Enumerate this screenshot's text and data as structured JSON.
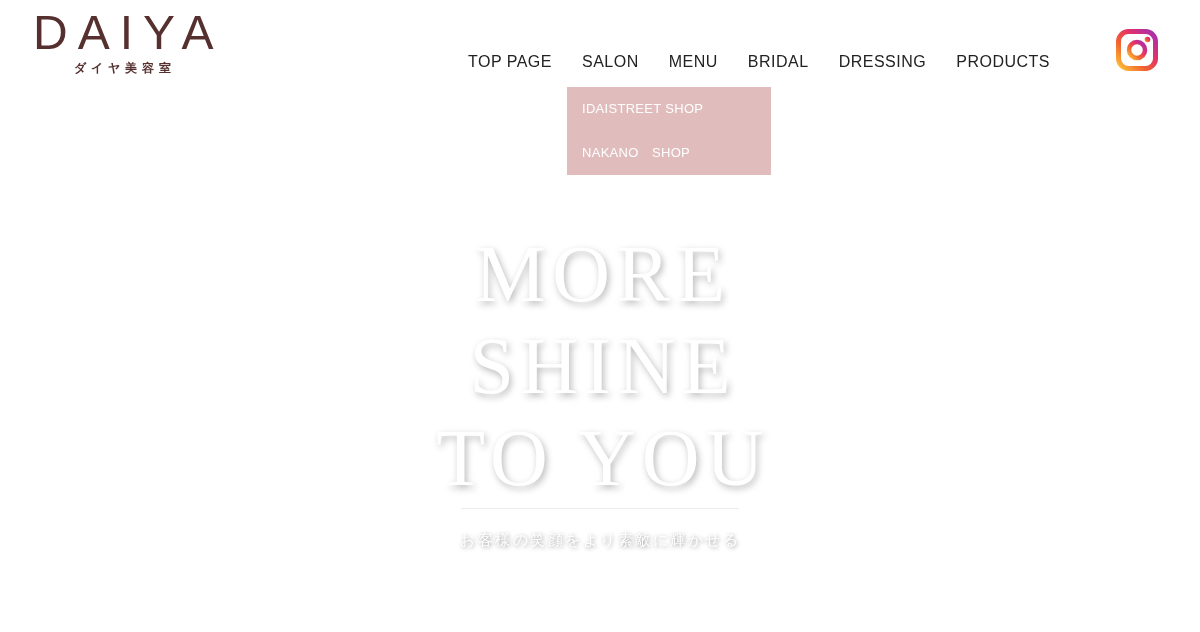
{
  "logo": {
    "wordmark": "DAIYA",
    "subtitle": "ダイヤ美容室"
  },
  "nav": [
    {
      "label": "TOP PAGE"
    },
    {
      "label": "SALON",
      "expanded": true,
      "submenu": [
        "IDAISTREET SHOP",
        "NAKANO　SHOP"
      ]
    },
    {
      "label": "MENU"
    },
    {
      "label": "BRIDAL"
    },
    {
      "label": "DRESSING"
    },
    {
      "label": "PRODUCTS"
    }
  ],
  "hero": {
    "lines": [
      "MORE",
      "SHINE",
      "TO YOU"
    ],
    "tagline": "お客様の笑顔をより素敵に輝かせる"
  }
}
